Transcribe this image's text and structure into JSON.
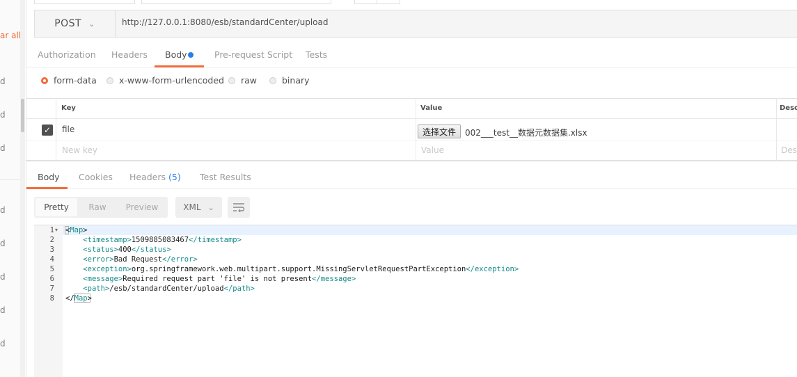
{
  "sidebar": {
    "clear_all": "ar all",
    "item_char": "d"
  },
  "request": {
    "method": "POST",
    "url": "http://127.0.0.1:8080/esb/standardCenter/upload",
    "tabs": [
      "Authorization",
      "Headers",
      "Body",
      "Pre-request Script",
      "Tests"
    ],
    "active_tab": "Body"
  },
  "body_types": [
    {
      "label": "form-data",
      "selected": true
    },
    {
      "label": "x-www-form-urlencoded",
      "selected": false
    },
    {
      "label": "raw",
      "selected": false
    },
    {
      "label": "binary",
      "selected": false
    }
  ],
  "params_table": {
    "headers": [
      "Key",
      "Value",
      "Desc"
    ],
    "row": {
      "key": "file",
      "checked": true,
      "file_button": "选择文件",
      "file_name": "002___test__数据元数据集.xlsx"
    },
    "placeholders": {
      "key": "New key",
      "value": "Value",
      "desc": "Desc"
    }
  },
  "response": {
    "tabs": {
      "body": "Body",
      "cookies": "Cookies",
      "headers": "Headers",
      "headers_count": "(5)",
      "tests": "Test Results"
    },
    "view_modes": [
      "Pretty",
      "Raw",
      "Preview"
    ],
    "language": "XML",
    "lines": [
      {
        "n": "1",
        "indent": "",
        "tag": "Map",
        "text": "",
        "close": false,
        "empty": true
      },
      {
        "n": "2",
        "indent": "    ",
        "tag": "timestamp",
        "text": "1509885083467",
        "close": true
      },
      {
        "n": "3",
        "indent": "    ",
        "tag": "status",
        "text": "400",
        "close": true
      },
      {
        "n": "4",
        "indent": "    ",
        "tag": "error",
        "text": "Bad Request",
        "close": true
      },
      {
        "n": "5",
        "indent": "    ",
        "tag": "exception",
        "text": "org.springframework.web.multipart.support.MissingServletRequestPartException",
        "close": true
      },
      {
        "n": "6",
        "indent": "    ",
        "tag": "message",
        "text": "Required request part 'file' is not present",
        "close": true
      },
      {
        "n": "7",
        "indent": "    ",
        "tag": "path",
        "text": "/esb/standardCenter/upload",
        "close": true
      },
      {
        "n": "8",
        "indent": "",
        "tag": "Map",
        "text": "",
        "close": false,
        "closing": true
      }
    ]
  },
  "colors": {
    "accent": "#f26b3a",
    "link_blue": "#2a7fe8",
    "xml_tag": "#178a8a"
  }
}
